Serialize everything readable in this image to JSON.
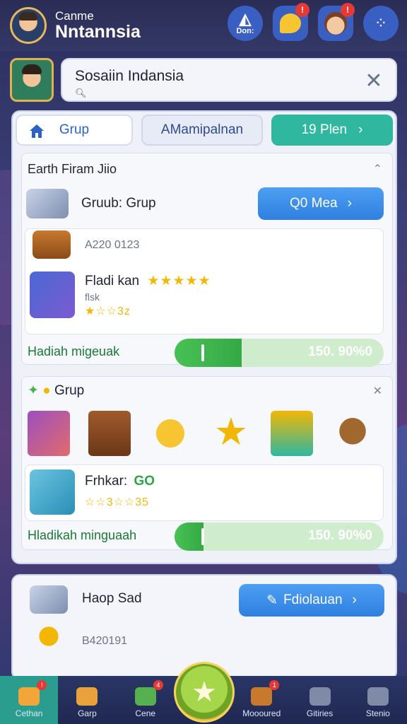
{
  "header": {
    "title_line1": "Canme",
    "title_line2": "Nntannsia",
    "icons": [
      {
        "name": "don-icon",
        "label": "Don:",
        "badge": ""
      },
      {
        "name": "chat-icon",
        "label": "",
        "badge": "!"
      },
      {
        "name": "profile-face-icon",
        "label": "",
        "badge": "!"
      },
      {
        "name": "menu-icon",
        "label": "",
        "badge": ""
      }
    ]
  },
  "search": {
    "value": "Sosaiin Indansia",
    "clear_icon": "close-icon"
  },
  "tabs": [
    {
      "label": "Grup",
      "icon": "home-icon"
    },
    {
      "label": "AMamipalnan",
      "icon": ""
    },
    {
      "label": "19 Plen",
      "icon": "chevron-right-icon"
    }
  ],
  "card1": {
    "title": "Earth Firam Jiio",
    "row1_label": "Gruub: Grup",
    "row1_button": "Q0 Mea",
    "row2_id": "A220 0123",
    "row3_title": "Fladi kan",
    "row3_stars": "★★★★★",
    "row3_sub1": "flsk",
    "row3_sub2": "★☆☆3z",
    "progress_label": "Hadiah migeuak",
    "progress_value": "150. 90%0",
    "progress_fraction": 0.32
  },
  "card2": {
    "title": "Grup",
    "detail_title": "Frhkar:",
    "detail_go": "GO",
    "detail_sub": "☆☆3☆☆35",
    "progress_label": "Hladikah minguaah",
    "progress_value": "150. 90%0",
    "progress_fraction": 0.14
  },
  "card3": {
    "label": "Haop Sad",
    "button": "Fdiolauan",
    "id": "B420191"
  },
  "nav": [
    {
      "label": "Cethan",
      "badge": "!"
    },
    {
      "label": "Garp",
      "badge": ""
    },
    {
      "label": "Cene",
      "badge": "4"
    },
    {
      "label": "Moooured",
      "badge": "1"
    },
    {
      "label": "Gitiries",
      "badge": ""
    },
    {
      "label": "Stenio",
      "badge": ""
    }
  ],
  "colors": {
    "accent_blue": "#2f7fe0",
    "accent_teal": "#2fb7a0",
    "progress_green": "#47c155",
    "gold": "#f2b705"
  }
}
